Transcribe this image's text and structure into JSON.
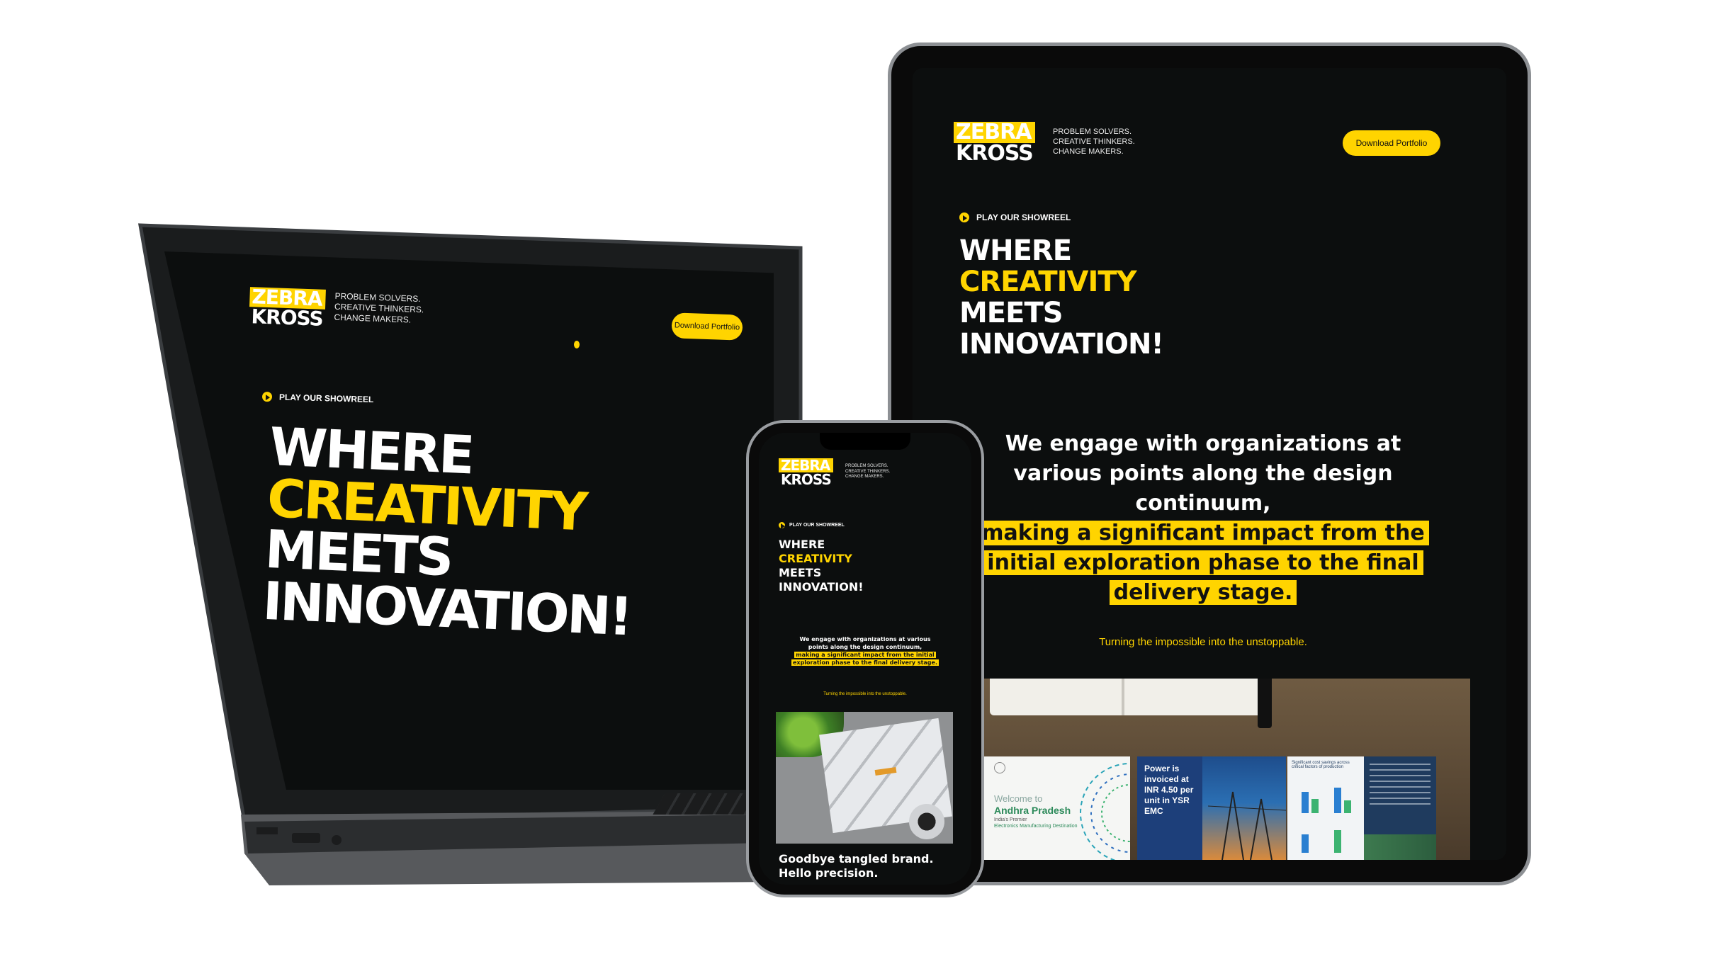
{
  "brand": {
    "logo_line1": "ZEBRA",
    "logo_line2": "KROSS",
    "tagline": [
      "PROBLEM SOLVERS.",
      "CREATIVE THINKERS.",
      "CHANGE MAKERS."
    ],
    "accent": "#ffd400",
    "background": "#0c0e0e"
  },
  "header": {
    "download_label": "Download Portfolio"
  },
  "showreel": {
    "label": "PLAY OUR SHOWREEL",
    "icon": "play-icon"
  },
  "hero": {
    "line1": "WHERE",
    "line2": "CREATIVITY",
    "line3": "MEETS",
    "line4": "INNOVATION!"
  },
  "intro": {
    "plain": "We engage with organizations at various points along the design continuum,",
    "highlight": "making a significant impact from the initial exploration phase to the final delivery stage.",
    "tagline": "Turning the impossible into the unstoppable."
  },
  "gallery": {
    "welcome_prefix": "Welcome to",
    "welcome_place": "Andhra Pradesh",
    "welcome_sub1": "India's Premier",
    "welcome_sub2": "Electronics Manufacturing Destination",
    "power_text": "Power is invoiced at INR 4.50 per unit in YSR EMC",
    "savings_title": "Significant cost savings across critical factors of production"
  },
  "phone_section": {
    "title_line1": "Goodbye tangled brand.",
    "title_line2": "Hello precision."
  }
}
